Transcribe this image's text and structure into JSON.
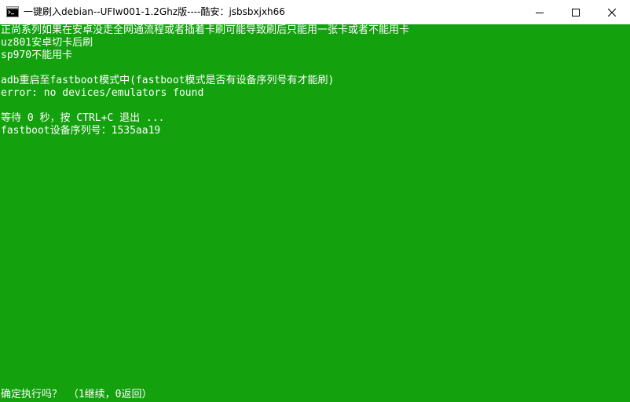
{
  "window": {
    "title": "一键刷入debian--UFIw001-1.2Ghz版----酷安：jsbsbxjxh66",
    "app_icon": "cmd-console-icon",
    "minimize_icon": "minimize-icon",
    "maximize_icon": "maximize-icon",
    "close_icon": "close-icon"
  },
  "colors": {
    "console_background": "#13a10e",
    "console_text": "#ffffff",
    "titlebar_background": "#ffffff"
  },
  "console": {
    "lines": [
      "正尚系列如果在安卓没走全网通流程或者插着卡刷可能导致刷后只能用一张卡或者不能用卡",
      "uz801安卓切卡后刷",
      "sp970不能用卡",
      "",
      "adb重启至fastboot模式中(fastboot模式是否有设备序列号有才能刷)",
      "error: no devices/emulators found",
      "",
      "等待 0 秒，按 CTRL+C 退出 ...",
      "fastboot设备序列号：1535aa19"
    ],
    "prompt": "确定执行吗？ （1继续，0返回）"
  }
}
